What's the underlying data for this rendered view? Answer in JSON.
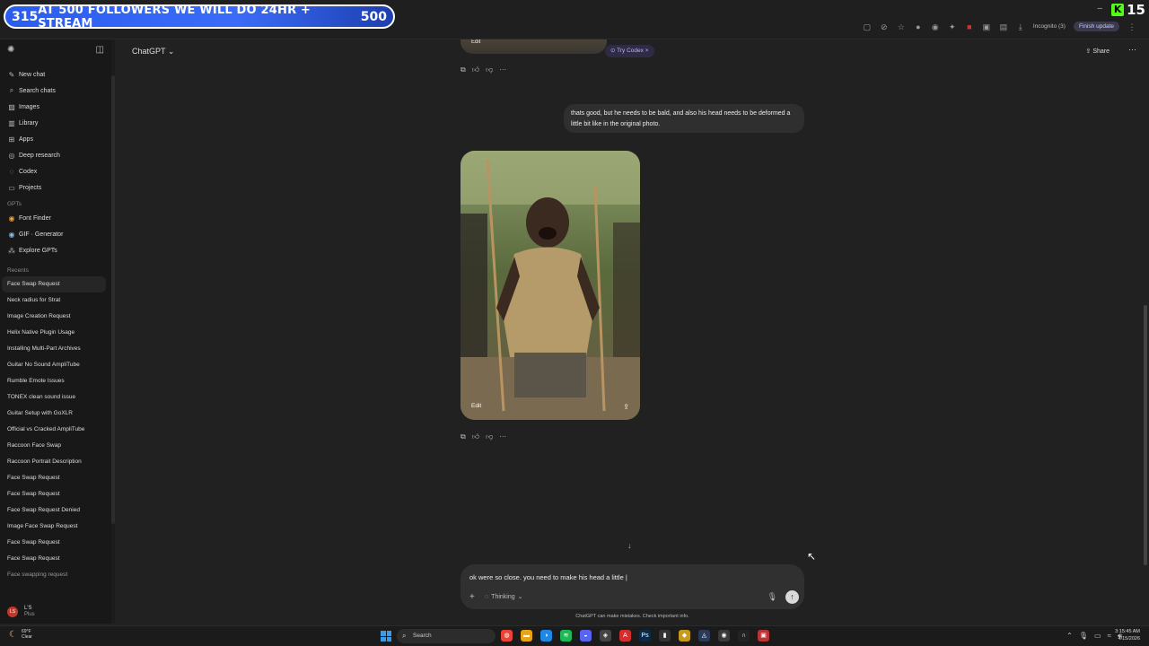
{
  "stream_overlay": {
    "count_left": "315",
    "message": "AT 500 FOLLOWERS WE WILL DO 24HR + STREAM",
    "count_right": "500",
    "kick_count": "15"
  },
  "browser": {
    "incognito_label": "Incognito (3)",
    "finish_update_label": "Finish update"
  },
  "sidebar": {
    "nav": [
      {
        "label": "New chat",
        "icon": "new-chat-icon"
      },
      {
        "label": "Search chats",
        "icon": "search-icon"
      },
      {
        "label": "Images",
        "icon": "images-icon"
      },
      {
        "label": "Library",
        "icon": "library-icon"
      },
      {
        "label": "Apps",
        "icon": "apps-icon"
      },
      {
        "label": "Deep research",
        "icon": "deep-research-icon"
      },
      {
        "label": "Codex",
        "icon": "codex-icon"
      },
      {
        "label": "Projects",
        "icon": "projects-icon"
      }
    ],
    "gpts_heading": "GPTs",
    "gpts": [
      {
        "label": "Font Finder"
      },
      {
        "label": "GIF · Generator"
      },
      {
        "label": "Explore GPTs"
      }
    ],
    "recents_heading": "Recents",
    "recents": [
      "Face Swap Request",
      "Neck radius for Strat",
      "Image Creation Request",
      "Helix Native Plugin Usage",
      "Installing Multi-Part Archives",
      "Guitar No Sound AmpliTube",
      "Rumble Emote Issues",
      "TONEX clean sound issue",
      "Guitar Setup with GoXLR",
      "Official vs Cracked AmpliTube",
      "Raccoon Face Swap",
      "Raccoon Portrait Description",
      "Face Swap Request",
      "Face Swap Request",
      "Face Swap Request Denied",
      "Image Face Swap Request",
      "Face Swap Request",
      "Face Swap Request",
      "Face swapping request"
    ],
    "user": {
      "initials": "LS",
      "name": "L'S",
      "plan": "Plus"
    }
  },
  "header": {
    "model_name": "ChatGPT",
    "share_label": "Share"
  },
  "chat": {
    "prev_image_edit": "Edit",
    "try_codex": "Try Codex",
    "user_message": "thats good, but he needs to be bald, and also his head needs to be deformed a little bit like in the original photo.",
    "image_edit_label": "Edit"
  },
  "composer": {
    "value": "ok were so close. you need to make his head a little |",
    "mode_label": "Thinking",
    "disclaimer": "ChatGPT can make mistakes. Check important info."
  },
  "taskbar": {
    "weather_temp": "69°F",
    "weather_desc": "Clear",
    "search_placeholder": "Search",
    "time": "3:15:45 AM",
    "date": "4/15/2026"
  }
}
